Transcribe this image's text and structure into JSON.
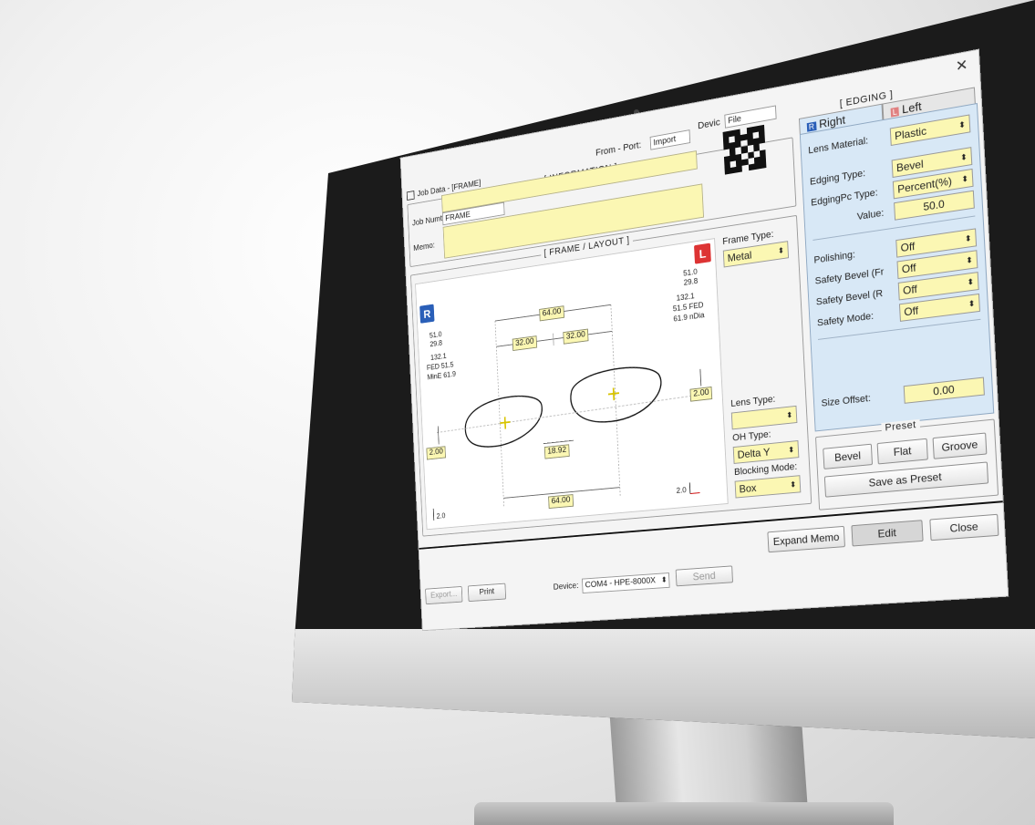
{
  "window": {
    "title": "Job Data - [FRAME]"
  },
  "information": {
    "label": "[ INFORMATION ]",
    "from_port_label": "From - Port:",
    "from_port_value": "Import",
    "device_label": "Devic",
    "device_value": "File",
    "job_number_label": "Job Numt",
    "job_number_value": "FRAME",
    "memo_label": "Memo:"
  },
  "frame_layout": {
    "label": "[ FRAME / LAYOUT ]",
    "right_badge": "R",
    "left_badge": "L",
    "right_stats": [
      "51.0",
      "29.8",
      "132.1",
      "FED 51.5",
      "MinE 61.9"
    ],
    "left_stats": [
      "51.0",
      "29.8",
      "132.1",
      "51.5 FED",
      "61.9 nDia"
    ],
    "dims": {
      "top_total": "64.00",
      "right_half": "32.00",
      "left_half": "32.00",
      "bridge": "18.92",
      "bottom_total": "64.00",
      "right_height": "2.00",
      "left_height": "2.00"
    },
    "corner_left": "2.0",
    "corner_right": "2.0",
    "frame_type_label": "Frame Type:",
    "frame_type_value": "Metal",
    "lens_type_label": "Lens Type:",
    "lens_type_value": "",
    "oh_type_label": "OH Type:",
    "oh_type_value": "Delta Y",
    "blocking_mode_label": "Blocking Mode:",
    "blocking_mode_value": "Box"
  },
  "edging": {
    "label": "[ EDGING ]",
    "tabs": [
      {
        "label": "Right",
        "badge": "R"
      },
      {
        "label": "Left",
        "badge": "L"
      }
    ],
    "lens_material_label": "Lens Material:",
    "lens_material_value": "Plastic",
    "edging_type_label": "Edging Type:",
    "edging_type_value": "Bevel",
    "edging_pos_type_label": "EdgingPc Type:",
    "edging_pos_type_value": "Percent(%)",
    "value_label": "Value:",
    "value_value": "50.0",
    "polishing_label": "Polishing:",
    "polishing_value": "Off",
    "safety_bevel_fr_label": "Safety Bevel (Fr",
    "safety_bevel_fr_value": "Off",
    "safety_bevel_r_label": "Safety Bevel (R",
    "safety_bevel_r_value": "Off",
    "safety_mode_label": "Safety Mode:",
    "safety_mode_value": "Off",
    "size_offset_label": "Size Offset:",
    "size_offset_value": "0.00"
  },
  "preset": {
    "label": "Preset",
    "bevel": "Bevel",
    "flat": "Flat",
    "groove": "Groove",
    "save_as_preset": "Save as Preset"
  },
  "footer": {
    "expand_memo": "Expand Memo",
    "edit": "Edit",
    "close": "Close",
    "export": "Export...",
    "print": "Print",
    "device_label": "Device:",
    "device_value": "COM4 - HPE-8000X",
    "send": "Send"
  }
}
